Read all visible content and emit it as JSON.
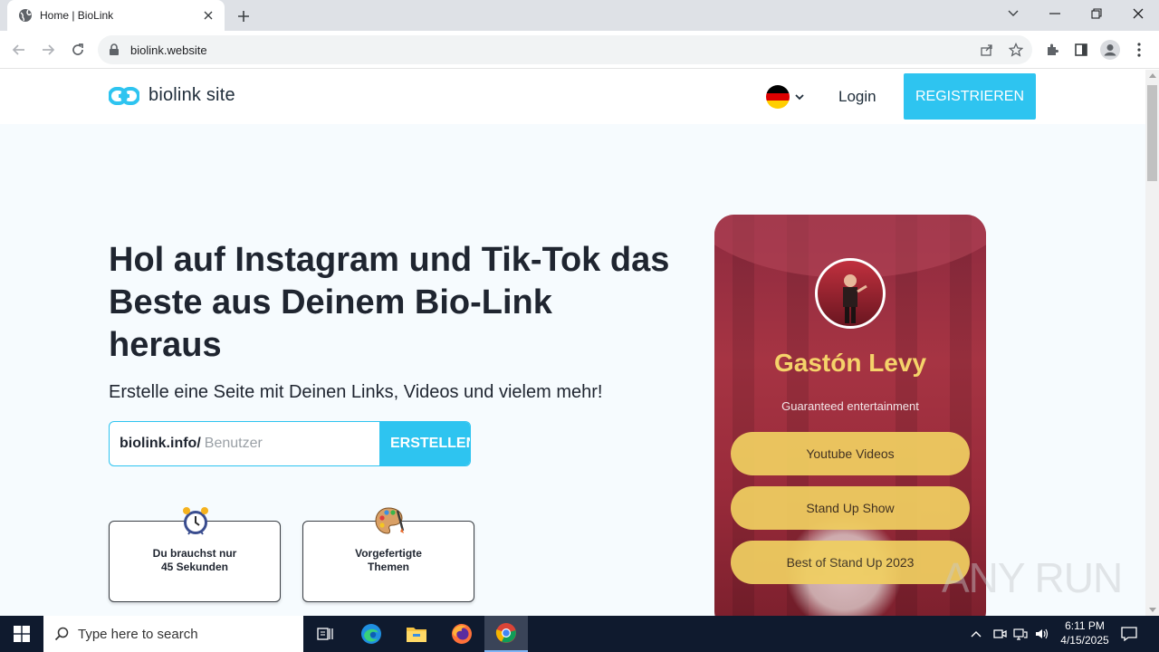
{
  "browser": {
    "tab_title": "Home | BioLink",
    "url": "biolink.website"
  },
  "site": {
    "logo_text": "biolink site",
    "login_label": "Login",
    "register_label": "REGISTRIEREN",
    "language_flag": "de-flag"
  },
  "hero": {
    "title": "Hol auf Instagram und Tik-Tok das Beste aus Deinem Bio-Link heraus",
    "subtitle": "Erstelle eine Seite mit Deinen Links, Videos und vielem mehr!",
    "claim_prefix": "biolink.info/",
    "claim_placeholder": "Benutzer",
    "claim_button": "ERSTELLEN"
  },
  "features": [
    {
      "icon": "alarm-clock-icon",
      "text": "Du brauchst nur\n45 Sekunden"
    },
    {
      "icon": "palette-icon",
      "text": "Vorgefertigte\nThemen"
    }
  ],
  "phone_preview": {
    "name": "Gastón Levy",
    "tagline": "Guaranteed entertainment",
    "links": [
      "Youtube Videos",
      "Stand Up Show",
      "Best of Stand Up 2023"
    ]
  },
  "watermark": "ANY RUN",
  "taskbar": {
    "search_placeholder": "Type here to search",
    "time": "6:11 PM",
    "date": "4/15/2025"
  },
  "colors": {
    "accent": "#2ec4f0",
    "page_bg": "#f6fbfe",
    "phone_gold": "#f0cf61",
    "taskbar": "#0f1a2e"
  }
}
